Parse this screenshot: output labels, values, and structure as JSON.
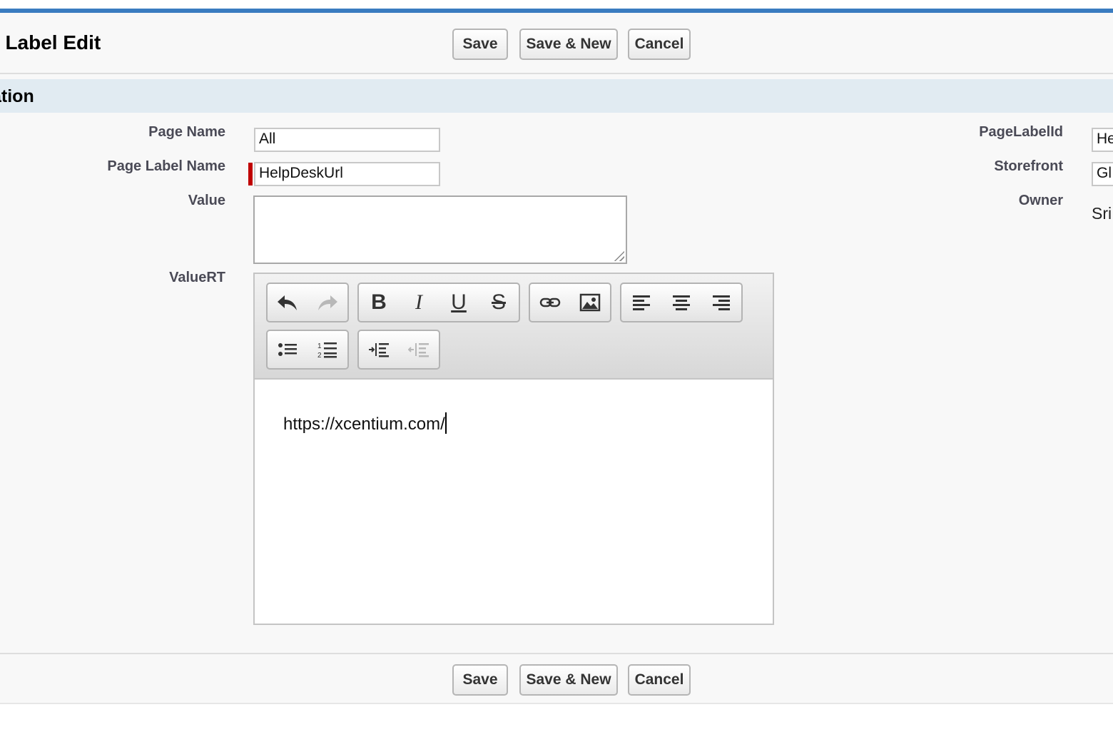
{
  "header": {
    "title": "ge Label Edit",
    "buttons": {
      "save": "Save",
      "save_new": "Save & New",
      "cancel": "Cancel"
    }
  },
  "section": {
    "title": "ation"
  },
  "fields": {
    "page_name": {
      "label": "Page Name",
      "value": "All"
    },
    "page_label_name": {
      "label": "Page Label Name",
      "value": "HelpDeskUrl",
      "required": true
    },
    "value": {
      "label": "Value",
      "value": ""
    },
    "value_rt": {
      "label": "ValueRT",
      "content": "https://xcentium.com/"
    },
    "page_label_id": {
      "label": "PageLabelId",
      "value": "He"
    },
    "storefront": {
      "label": "Storefront",
      "value": "Gl"
    },
    "owner": {
      "label": "Owner",
      "value": "Sri"
    }
  },
  "toolbar": {
    "groups": [
      [
        "undo-icon",
        "redo-icon"
      ],
      [
        "bold-icon",
        "italic-icon",
        "underline-icon",
        "strikethrough-icon"
      ],
      [
        "link-icon",
        "image-icon"
      ],
      [
        "align-left-icon",
        "align-center-icon",
        "align-right-icon"
      ],
      [
        "bulleted-list-icon",
        "numbered-list-icon"
      ],
      [
        "indent-icon",
        "outdent-icon"
      ]
    ],
    "letters": {
      "bold": "B",
      "italic": "I",
      "underline": "U",
      "strike": "S"
    }
  },
  "footer": {
    "buttons": {
      "save": "Save",
      "save_new": "Save & New",
      "cancel": "Cancel"
    }
  },
  "colors": {
    "accent": "#3a7cc0",
    "section_bg": "#e1ebf2",
    "required": "#c00000"
  }
}
